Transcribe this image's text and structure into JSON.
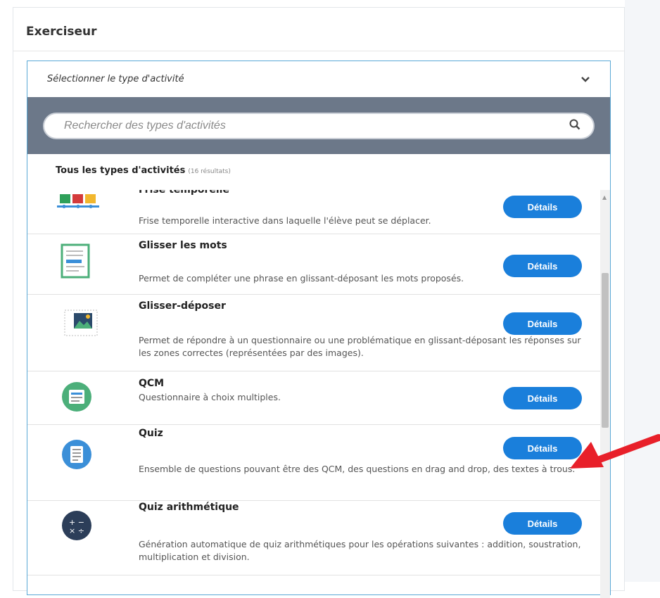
{
  "panel": {
    "title": "Exerciseur"
  },
  "dropdown": {
    "label": "Sélectionner le type d'activité",
    "icon": "chevron-down-icon"
  },
  "search": {
    "placeholder": "Rechercher des types d'activités",
    "icon": "search-icon"
  },
  "results": {
    "label": "Tous les types d'activités",
    "count": "(16 résultats)"
  },
  "items": [
    {
      "name": "Frise temporelle",
      "description": "Frise temporelle interactive dans laquelle l'élève peut se déplacer.",
      "button": "Détails",
      "icon": "timeline-icon"
    },
    {
      "name": "Glisser les mots",
      "description": "Permet de compléter une phrase en glissant-déposant les mots proposés.",
      "button": "Détails",
      "icon": "document-icon"
    },
    {
      "name": "Glisser-déposer",
      "description": "Permet de répondre à un questionnaire ou une problématique en glissant-déposant les réponses sur les zones correctes (représentées par des images).",
      "button": "Détails",
      "icon": "image-drop-icon"
    },
    {
      "name": "QCM",
      "description": "Questionnaire à choix multiples.",
      "button": "Détails",
      "icon": "multiple-choice-icon"
    },
    {
      "name": "Quiz",
      "description": "Ensemble de questions pouvant être des QCM, des questions en drag and drop, des textes à trous.",
      "button": "Détails",
      "icon": "quiz-icon"
    },
    {
      "name": "Quiz arithmétique",
      "description": "Génération automatique de quiz arithmétiques pour les opérations suivantes : addition, soustration, multiplication et division.",
      "button": "Détails",
      "icon": "arithmetic-icon"
    }
  ],
  "colors": {
    "accent": "#1a7fdb",
    "search_band": "#6c7889",
    "arrow": "#e8202a"
  }
}
